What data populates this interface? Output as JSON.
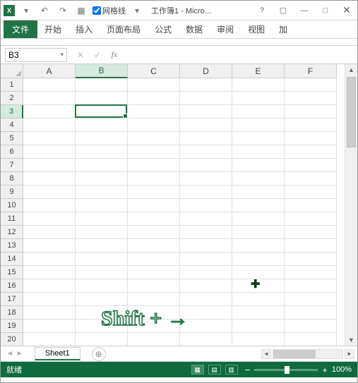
{
  "title": "工作簿1 - Micro...",
  "qat_checkbox_label": "网格线",
  "tabs": {
    "file": "文件",
    "home": "开始",
    "insert": "插入",
    "layout": "页面布局",
    "formulas": "公式",
    "data": "数据",
    "review": "审阅",
    "view": "视图",
    "addins": "加"
  },
  "name_box": "B3",
  "fx_label": "fx",
  "columns": [
    "A",
    "B",
    "C",
    "D",
    "E",
    "F"
  ],
  "rows": [
    "1",
    "2",
    "3",
    "4",
    "5",
    "6",
    "7",
    "8",
    "9",
    "10",
    "11",
    "12",
    "13",
    "14",
    "15",
    "16",
    "17",
    "18",
    "19",
    "20"
  ],
  "selected_col": "B",
  "selected_row": "3",
  "sheet_tab": "Sheet1",
  "status_text": "就绪",
  "zoom_text": "100%",
  "overlay_hint": "Shift + →",
  "icons": {
    "undo": "↶",
    "redo": "↷",
    "table": "▦",
    "dropdown": "▾",
    "help": "?",
    "ribbon_opts": "▢",
    "minimize": "—",
    "close": "✕",
    "plus": "⊕",
    "cancel": "✕",
    "enter": "✓",
    "left": "◄",
    "right": "►",
    "up": "▲",
    "down": "▼",
    "minus": "−",
    "plus2": "+"
  }
}
